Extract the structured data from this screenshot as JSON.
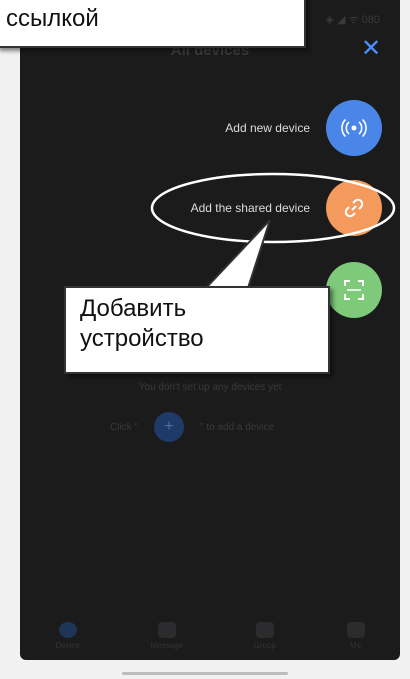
{
  "callout_top": {
    "text": "ссылкой"
  },
  "callout_main": {
    "line1": "Добавить",
    "line2": "устройство"
  },
  "screen": {
    "status": "◈ ◢ ᯤ 080",
    "title": "All devices",
    "close_icon": "close-icon"
  },
  "actions": [
    {
      "label": "Add new device",
      "color": "#4a86e8",
      "icon": "broadcast-icon"
    },
    {
      "label": "Add the shared device",
      "color": "#f39a5c",
      "icon": "link-icon"
    },
    {
      "label": "",
      "color": "#7ec97a",
      "icon": "scan-icon"
    }
  ],
  "empty": {
    "text": "You don't set up any devices yet",
    "hint_prefix": "Click \"",
    "hint_suffix": "\" to add a device"
  },
  "tabs": [
    {
      "label": "Device",
      "icon": "home-icon"
    },
    {
      "label": "Message",
      "icon": "message-icon"
    },
    {
      "label": "Group",
      "icon": "group-icon"
    },
    {
      "label": "Me",
      "icon": "person-icon"
    }
  ],
  "colors": {
    "accent": "#4a86e8",
    "background": "#1b1b1c"
  }
}
